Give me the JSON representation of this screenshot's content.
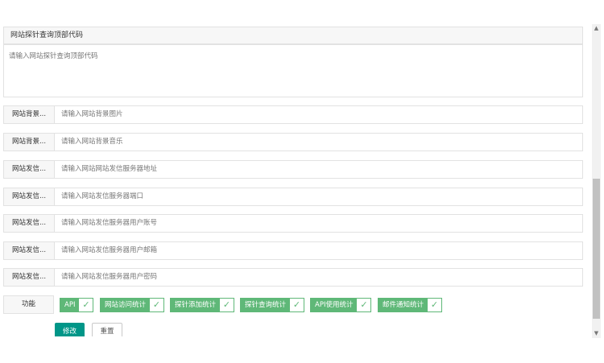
{
  "header_code": {
    "title": "网站探针查询顶部代码",
    "placeholder": "请输入网站探针查询顶部代码"
  },
  "fields": [
    {
      "label": "网站背景...",
      "placeholder": "请输入网站背景图片"
    },
    {
      "label": "网站背景...",
      "placeholder": "请输入网站背景音乐"
    },
    {
      "label": "网站发信...",
      "placeholder": "请输入网站网站发信服务器地址"
    },
    {
      "label": "网站发信...",
      "placeholder": "请输入网站发信服务器端口"
    },
    {
      "label": "网站发信...",
      "placeholder": "请输入网站发信服务器用户账号"
    },
    {
      "label": "网站发信...",
      "placeholder": "请输入网站发信服务器用户邮箱"
    },
    {
      "label": "网站发信...",
      "placeholder": "请输入网站发信服务器用户密码"
    }
  ],
  "functions": {
    "label": "功能",
    "options": [
      {
        "label": "API",
        "checked": true
      },
      {
        "label": "网站访问统计",
        "checked": true
      },
      {
        "label": "探针添加统计",
        "checked": true
      },
      {
        "label": "探针查询统计",
        "checked": true
      },
      {
        "label": "API使用统计",
        "checked": true
      },
      {
        "label": "邮件通知统计",
        "checked": true
      }
    ],
    "check_glyph": "✓"
  },
  "buttons": {
    "submit": "修改",
    "reset": "重置"
  },
  "colors": {
    "checkbox_green": "#5fb878",
    "primary_teal": "#009688"
  },
  "icons": {
    "scroll_up": "chevron-up-icon",
    "scroll_down": "chevron-down-icon",
    "check": "check-icon"
  },
  "scrollbar": {
    "up_glyph": "▲",
    "down_glyph": "▼"
  }
}
